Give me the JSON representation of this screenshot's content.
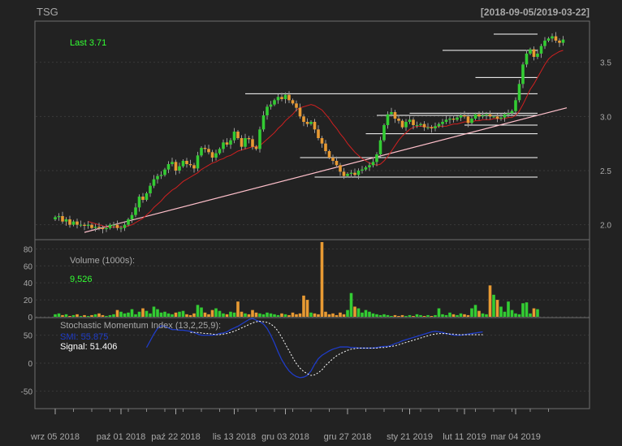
{
  "header": {
    "symbol": "TSG",
    "date_range": "[2018-09-05/2019-03-22]"
  },
  "colors": {
    "background": "#222222",
    "panel_border": "#6e6e6e",
    "grid": "#3a3a3a",
    "axis_text": "#a8a8a8",
    "up": "#33cc33",
    "down": "#e89a33",
    "ma": "#d02020",
    "trend": "#ffc0cb",
    "levels": "#ffffff",
    "legend_green": "#33ff33",
    "smi": "#1f3cc8",
    "signal": "#ffffff"
  },
  "chart_data": [
    {
      "type": "candlestick",
      "legend": {
        "label": "Last 3.71"
      },
      "y_ticks": [
        "2.0",
        "2.5",
        "3.0",
        "3.5"
      ],
      "ylim": [
        1.9,
        3.85
      ],
      "x_tick_labels": [
        "wrz 05 2018",
        "paź 01 2018",
        "paź 22 2018",
        "lis 13 2018",
        "gru 03 2018",
        "gru 27 2018",
        "sty 21 2019",
        "lut 11 2019",
        "mar 04 2019"
      ],
      "x_tick_index": [
        0,
        18,
        33,
        49,
        63,
        80,
        97,
        112,
        126
      ],
      "n_sessions": 140,
      "closes": [
        2.07,
        2.08,
        2.03,
        2.05,
        2.0,
        2.03,
        2.0,
        2.0,
        1.99,
        2.0,
        1.97,
        1.98,
        1.97,
        1.96,
        1.97,
        2.0,
        2.0,
        1.97,
        1.97,
        2.0,
        2.05,
        2.09,
        2.16,
        2.26,
        2.23,
        2.29,
        2.36,
        2.42,
        2.45,
        2.46,
        2.51,
        2.56,
        2.58,
        2.5,
        2.54,
        2.59,
        2.56,
        2.55,
        2.52,
        2.64,
        2.71,
        2.7,
        2.67,
        2.62,
        2.66,
        2.7,
        2.76,
        2.74,
        2.78,
        2.86,
        2.8,
        2.72,
        2.8,
        2.79,
        2.72,
        2.7,
        2.88,
        3.01,
        3.09,
        3.11,
        3.15,
        3.18,
        3.16,
        3.2,
        3.15,
        3.12,
        3.08,
        3.0,
        2.95,
        2.93,
        2.95,
        2.88,
        2.8,
        2.75,
        2.68,
        2.62,
        2.59,
        2.55,
        2.49,
        2.45,
        2.47,
        2.48,
        2.46,
        2.5,
        2.51,
        2.53,
        2.55,
        2.58,
        2.65,
        2.78,
        2.92,
        3.02,
        3.04,
        2.98,
        2.96,
        2.9,
        2.95,
        2.97,
        2.92,
        2.92,
        2.93,
        2.9,
        2.9,
        2.89,
        2.91,
        2.93,
        2.95,
        2.97,
        2.98,
        2.97,
        2.99,
        3.01,
        3.0,
        2.94,
        2.98,
        3.02,
        3.0,
        3.01,
        3.02,
        3.0,
        3.0,
        2.98,
        2.99,
        3.02,
        3.03,
        3.05,
        3.15,
        3.3,
        3.48,
        3.58,
        3.62,
        3.55,
        3.58,
        3.65,
        3.7,
        3.72,
        3.74,
        3.7,
        3.68,
        3.71
      ],
      "ma_values": [
        null,
        null,
        null,
        null,
        null,
        null,
        null,
        null,
        null,
        2.03,
        2.02,
        2.01,
        2.0,
        1.99,
        1.98,
        1.98,
        1.98,
        1.98,
        1.98,
        1.98,
        1.99,
        2.0,
        2.02,
        2.04,
        2.06,
        2.09,
        2.12,
        2.16,
        2.19,
        2.22,
        2.26,
        2.29,
        2.32,
        2.34,
        2.37,
        2.4,
        2.42,
        2.44,
        2.46,
        2.48,
        2.51,
        2.53,
        2.55,
        2.57,
        2.58,
        2.6,
        2.61,
        2.63,
        2.64,
        2.66,
        2.68,
        2.69,
        2.7,
        2.71,
        2.72,
        2.72,
        2.73,
        2.76,
        2.79,
        2.82,
        2.85,
        2.89,
        2.92,
        2.96,
        2.99,
        3.02,
        3.06,
        3.08,
        3.09,
        3.1,
        3.11,
        3.1,
        3.08,
        3.06,
        3.02,
        2.98,
        2.93,
        2.89,
        2.84,
        2.8,
        2.75,
        2.71,
        2.67,
        2.64,
        2.61,
        2.59,
        2.57,
        2.56,
        2.55,
        2.56,
        2.59,
        2.63,
        2.68,
        2.73,
        2.78,
        2.82,
        2.85,
        2.88,
        2.9,
        2.91,
        2.91,
        2.91,
        2.9,
        2.9,
        2.9,
        2.91,
        2.91,
        2.91,
        2.92,
        2.93,
        2.93,
        2.94,
        2.95,
        2.95,
        2.95,
        2.96,
        2.96,
        2.97,
        2.97,
        2.97,
        2.98,
        2.98,
        2.98,
        2.98,
        2.99,
        2.99,
        3.01,
        3.05,
        3.11,
        3.18,
        3.25,
        3.3,
        3.36,
        3.42,
        3.48,
        3.53,
        3.56,
        3.58,
        3.6,
        3.61
      ],
      "trend_line": {
        "from": [
          8,
          1.93
        ],
        "to": [
          140,
          3.08
        ]
      },
      "h_levels": [
        {
          "from": 120,
          "to": 132,
          "value": 3.76
        },
        {
          "from": 106,
          "to": 132,
          "value": 3.61
        },
        {
          "from": 115,
          "to": 132,
          "value": 3.36
        },
        {
          "from": 52,
          "to": 132,
          "value": 3.21
        },
        {
          "from": 97,
          "to": 132,
          "value": 3.03
        },
        {
          "from": 88,
          "to": 132,
          "value": 3.01
        },
        {
          "from": 112,
          "to": 132,
          "value": 2.92
        },
        {
          "from": 85,
          "to": 132,
          "value": 2.84
        },
        {
          "from": 67,
          "to": 132,
          "value": 2.62
        },
        {
          "from": 71,
          "to": 132,
          "value": 2.44
        }
      ]
    },
    {
      "type": "bar",
      "title": "Volume (1000s):",
      "last_value": "9,526",
      "y_ticks": [
        "0",
        "20",
        "40",
        "60",
        "80"
      ],
      "ylim": [
        0,
        88
      ],
      "values": [
        3,
        4,
        2,
        3,
        1,
        2,
        3,
        1,
        2,
        1,
        2,
        3,
        4,
        2,
        1,
        2,
        3,
        8,
        6,
        4,
        5,
        9,
        3,
        6,
        10,
        7,
        4,
        12,
        9,
        5,
        6,
        4,
        3,
        5,
        6,
        7,
        3,
        2,
        4,
        14,
        11,
        5,
        3,
        8,
        10,
        7,
        4,
        3,
        6,
        5,
        18,
        6,
        4,
        3,
        8,
        5,
        4,
        3,
        5,
        4,
        3,
        2,
        4,
        3,
        2,
        5,
        3,
        4,
        25,
        20,
        5,
        4,
        3,
        88,
        6,
        3,
        4,
        2,
        5,
        3,
        8,
        28,
        12,
        10,
        5,
        8,
        6,
        4,
        3,
        2,
        3,
        2,
        1,
        2,
        1,
        2,
        1,
        2,
        1,
        3,
        2,
        1,
        2,
        1,
        2,
        10,
        3,
        2,
        5,
        3,
        2,
        4,
        3,
        2,
        10,
        14,
        7,
        4,
        3,
        37,
        26,
        20,
        12,
        6,
        18,
        8,
        4,
        3,
        16,
        17,
        4,
        10,
        9
      ]
    },
    {
      "type": "line",
      "title": "Stochastic Momentum Index (13,2,25,9):",
      "smi_label": "SMI: 55.875",
      "signal_label": "Signal: 51.406",
      "y_ticks": [
        "-50",
        "0",
        "50"
      ],
      "ylim": [
        -80,
        80
      ],
      "series": [
        {
          "name": "SMI",
          "values": [
            null,
            null,
            null,
            null,
            null,
            null,
            null,
            null,
            null,
            null,
            null,
            null,
            null,
            null,
            null,
            null,
            null,
            null,
            null,
            null,
            null,
            null,
            null,
            null,
            null,
            28,
            40,
            52,
            62,
            67,
            66,
            63,
            60,
            60,
            59,
            59,
            58,
            57,
            55,
            52,
            50,
            50,
            50,
            50,
            51,
            53,
            54,
            56,
            60,
            63,
            66,
            70,
            74,
            78,
            80,
            77,
            74,
            70,
            62,
            50,
            36,
            20,
            6,
            -5,
            -14,
            -20,
            -24,
            -26,
            -25,
            -22,
            -14,
            -2,
            8,
            14,
            18,
            22,
            25,
            27,
            29,
            29,
            29,
            28,
            28,
            27,
            27,
            27,
            27,
            27,
            28,
            29,
            30,
            30,
            32,
            35,
            37,
            40,
            42,
            44,
            46,
            48,
            50,
            52,
            54,
            56,
            57,
            56,
            55,
            53,
            52,
            50,
            50,
            50,
            51,
            52,
            53,
            54,
            55,
            56
          ]
        },
        {
          "name": "Signal",
          "values": [
            null,
            null,
            null,
            null,
            null,
            null,
            null,
            null,
            null,
            null,
            null,
            null,
            null,
            null,
            null,
            null,
            null,
            null,
            null,
            null,
            null,
            null,
            null,
            null,
            null,
            null,
            null,
            null,
            null,
            null,
            null,
            null,
            null,
            null,
            null,
            null,
            null,
            55,
            55,
            55,
            54,
            53,
            53,
            52,
            51,
            51,
            52,
            53,
            55,
            57,
            60,
            63,
            66,
            69,
            72,
            74,
            75,
            74,
            73,
            70,
            65,
            57,
            46,
            34,
            22,
            10,
            -1,
            -9,
            -15,
            -19,
            -22,
            -21,
            -17,
            -12,
            -4,
            2,
            8,
            13,
            17,
            20,
            23,
            25,
            26,
            27,
            27,
            27,
            27,
            27,
            27,
            28,
            28,
            29,
            30,
            31,
            33,
            35,
            37,
            39,
            41,
            43,
            45,
            47,
            49,
            51,
            52,
            53,
            53,
            53,
            52,
            52,
            51,
            51,
            51,
            51,
            51,
            51,
            51,
            51
          ]
        }
      ]
    }
  ]
}
